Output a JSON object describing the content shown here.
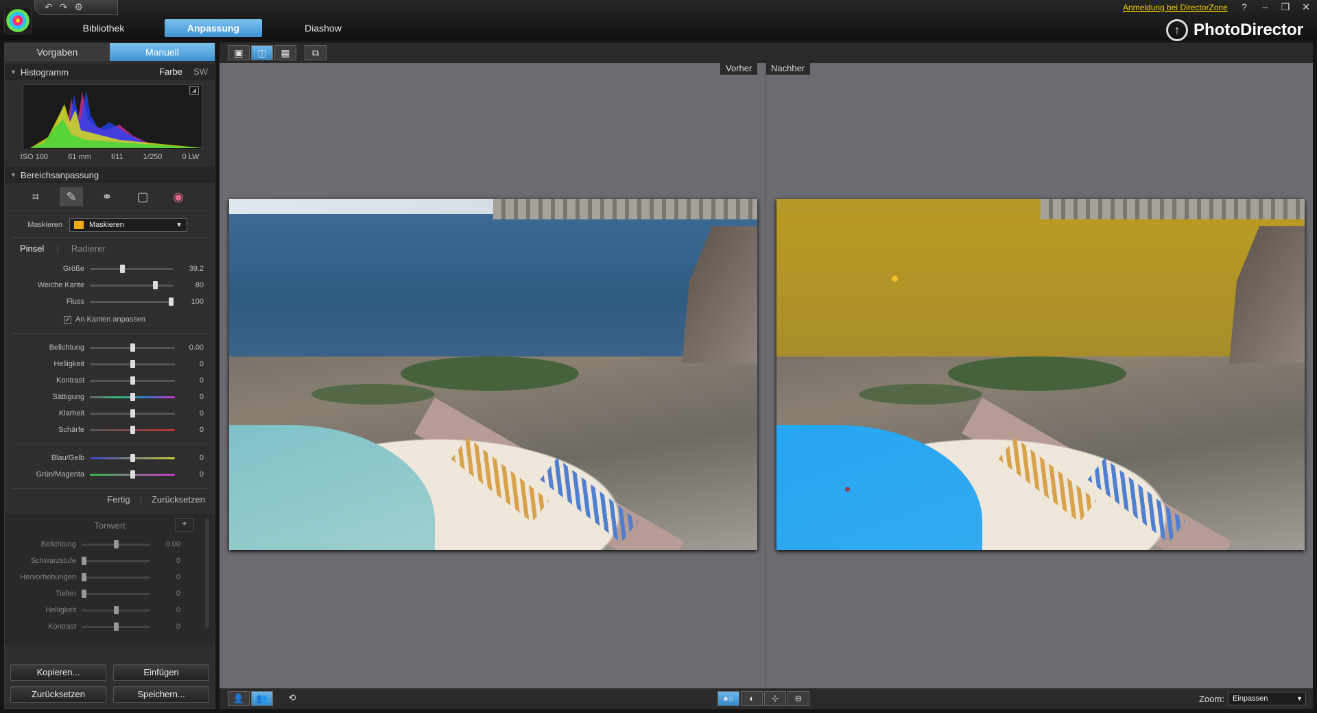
{
  "app": {
    "title": "PhotoDirector",
    "directorzone_link": "Anmeldung bei DirectorZone",
    "win_controls": [
      "?",
      "–",
      "❐",
      "✕"
    ]
  },
  "nav_tabs": [
    {
      "label": "Bibliothek",
      "active": false
    },
    {
      "label": "Anpassung",
      "active": true
    },
    {
      "label": "Diashow",
      "active": false
    }
  ],
  "mode_tabs": [
    {
      "label": "Vorgaben",
      "active": false
    },
    {
      "label": "Manuell",
      "active": true
    }
  ],
  "histogram": {
    "title": "Histogramm",
    "opt_color": "Farbe",
    "opt_bw": "SW",
    "info": [
      "ISO 100",
      "61 mm",
      "f/11",
      "1/250",
      "0 LW"
    ]
  },
  "area_adjust": {
    "title": "Bereichsanpassung",
    "mask_label": "Maskieren",
    "mask_value": "Maskieren",
    "mask_color": "#f0a818",
    "brush_tab": "Pinsel",
    "eraser_tab": "Radierer",
    "brush_sliders": [
      {
        "label": "Größe",
        "value": "39.2",
        "pos": 0.38
      },
      {
        "label": "Weiche Kante",
        "value": "80",
        "pos": 0.8
      },
      {
        "label": "Fluss",
        "value": "100",
        "pos": 1.0
      }
    ],
    "edge_checkbox": "An Kanten anpassen",
    "adjust_sliders": [
      {
        "label": "Belichtung",
        "value": "0.00",
        "pos": 0.5
      },
      {
        "label": "Helligkeit",
        "value": "0",
        "pos": 0.5
      },
      {
        "label": "Kontrast",
        "value": "0",
        "pos": 0.5
      },
      {
        "label": "Sättigung",
        "value": "0",
        "pos": 0.5
      },
      {
        "label": "Klarheit",
        "value": "0",
        "pos": 0.5
      },
      {
        "label": "Schärfe",
        "value": "0",
        "pos": 0.5
      }
    ],
    "color_sliders": [
      {
        "label": "Blau/Gelb",
        "value": "0",
        "pos": 0.5
      },
      {
        "label": "Grün/Magenta",
        "value": "0",
        "pos": 0.5
      }
    ],
    "done_label": "Fertig",
    "reset_label": "Zurücksetzen"
  },
  "tone": {
    "title": "Tonwert",
    "sliders": [
      {
        "label": "Belichtung",
        "value": "0.00",
        "pos": 0.5
      },
      {
        "label": "Schwarzstufe",
        "value": "0",
        "pos": 0.0
      },
      {
        "label": "Hervorhebungen",
        "value": "0",
        "pos": 0.0
      },
      {
        "label": "Tiefen",
        "value": "0",
        "pos": 0.0
      },
      {
        "label": "Helligkeit",
        "value": "0",
        "pos": 0.5
      },
      {
        "label": "Kontrast",
        "value": "0",
        "pos": 0.5
      }
    ]
  },
  "bottom_buttons": {
    "copy": "Kopieren...",
    "paste": "Einfügen",
    "reset": "Zurücksetzen",
    "save": "Speichern..."
  },
  "compare": {
    "before": "Vorher",
    "after": "Nachher"
  },
  "zoom": {
    "label": "Zoom:",
    "value": "Einpassen"
  },
  "colors": {
    "accent": "#3d93d3",
    "mask_yellow": "#b79a24",
    "mask_blue": "#2aa2ee",
    "link_yellow": "#f1d100"
  },
  "icons": {
    "qat": [
      "undo-icon",
      "redo-icon",
      "settings-icon"
    ],
    "tools": [
      "crop-icon",
      "brush-icon",
      "spot-removal-icon",
      "gradient-icon",
      "red-eye-icon"
    ]
  }
}
